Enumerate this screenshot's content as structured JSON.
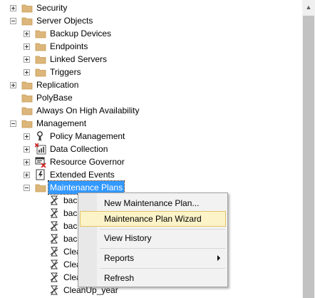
{
  "tree": {
    "items": [
      {
        "label": "Security",
        "icon": "folder-icon",
        "expander": "plus"
      },
      {
        "label": "Server Objects",
        "icon": "folder-icon",
        "expander": "minus"
      },
      {
        "label": "Backup Devices",
        "icon": "folder-icon",
        "expander": "plus"
      },
      {
        "label": "Endpoints",
        "icon": "folder-icon",
        "expander": "plus"
      },
      {
        "label": "Linked Servers",
        "icon": "folder-icon",
        "expander": "plus"
      },
      {
        "label": "Triggers",
        "icon": "folder-icon",
        "expander": "plus"
      },
      {
        "label": "Replication",
        "icon": "folder-icon",
        "expander": "plus"
      },
      {
        "label": "PolyBase",
        "icon": "folder-icon",
        "expander": "none"
      },
      {
        "label": "Always On High Availability",
        "icon": "folder-icon",
        "expander": "none"
      },
      {
        "label": "Management",
        "icon": "folder-icon",
        "expander": "minus"
      },
      {
        "label": "Policy Management",
        "icon": "policy-icon",
        "expander": "plus"
      },
      {
        "label": "Data Collection",
        "icon": "data-collection-icon",
        "expander": "plus"
      },
      {
        "label": "Resource Governor",
        "icon": "resource-governor-icon",
        "expander": "plus"
      },
      {
        "label": "Extended Events",
        "icon": "extended-events-icon",
        "expander": "plus"
      },
      {
        "label": "Maintenance Plans",
        "icon": "folder-icon",
        "expander": "minus",
        "selected": true
      },
      {
        "label": "bac",
        "icon": "maintenance-plan-icon",
        "expander": "none"
      },
      {
        "label": "bac",
        "icon": "maintenance-plan-icon",
        "expander": "none"
      },
      {
        "label": "bac",
        "icon": "maintenance-plan-icon",
        "expander": "none"
      },
      {
        "label": "bac",
        "icon": "maintenance-plan-icon",
        "expander": "none"
      },
      {
        "label": "Clea",
        "icon": "maintenance-plan-icon",
        "expander": "none"
      },
      {
        "label": "Clea",
        "icon": "maintenance-plan-icon",
        "expander": "none"
      },
      {
        "label": "Clea",
        "icon": "maintenance-plan-icon",
        "expander": "none"
      },
      {
        "label": "CleanUp_year",
        "icon": "maintenance-plan-icon",
        "expander": "none"
      }
    ]
  },
  "context_menu": {
    "new_plan": "New Maintenance Plan...",
    "wizard": "Maintenance Plan Wizard",
    "view_history": "View History",
    "reports": "Reports",
    "refresh": "Refresh"
  },
  "colors": {
    "selection": "#3399ff",
    "menu_hover": "#fcf3c8",
    "menu_hover_border": "#e5c365",
    "folder": "#dcb67a"
  }
}
